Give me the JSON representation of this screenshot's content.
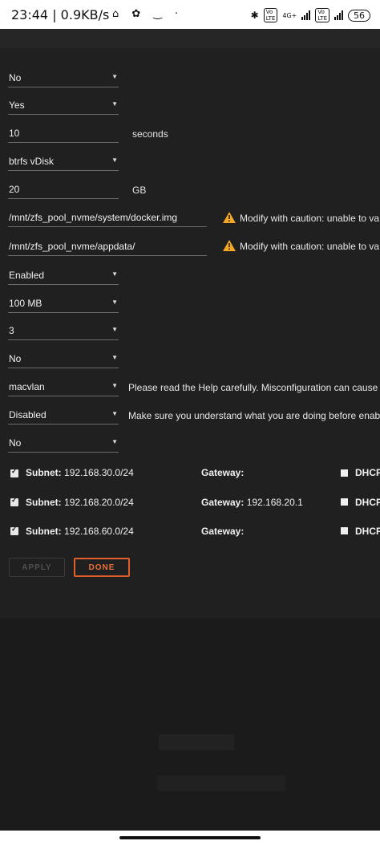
{
  "status_bar": {
    "time": "23:44 | 0.9KB/s",
    "network": "4G+",
    "battery": "56"
  },
  "settings": {
    "select_1": "No",
    "select_2": "Yes",
    "timeout_value": "10",
    "timeout_unit": "seconds",
    "vdisk_type": "btrfs vDisk",
    "vdisk_size": "20",
    "vdisk_unit": "GB",
    "docker_image_path": "/mnt/zfs_pool_nvme/system/docker.img",
    "docker_image_warning": "Modify with caution: unable to va",
    "appdata_path": "/mnt/zfs_pool_nvme/appdata/",
    "appdata_warning": "Modify with caution: unable to va",
    "log_rotation": "Enabled",
    "log_size": "100 MB",
    "log_count": "3",
    "select_no_2": "No",
    "network_type": "macvlan",
    "network_type_note": "Please read the Help carefully. Misconfiguration can cause p",
    "host_access": "Disabled",
    "host_access_note": "Make sure you understand what you are doing before enabl",
    "select_no_3": "No"
  },
  "networks": [
    {
      "subnet_label": "Subnet:",
      "subnet": "192.168.30.0/24",
      "gateway_label": "Gateway:",
      "gateway": "",
      "dhcp_label": "DHCP"
    },
    {
      "subnet_label": "Subnet:",
      "subnet": "192.168.20.0/24",
      "gateway_label": "Gateway:",
      "gateway": "192.168.20.1",
      "dhcp_label": "DHCP"
    },
    {
      "subnet_label": "Subnet:",
      "subnet": "192.168.60.0/24",
      "gateway_label": "Gateway:",
      "gateway": "",
      "dhcp_label": "DHCP"
    }
  ],
  "buttons": {
    "apply": "APPLY",
    "done": "DONE"
  },
  "colors": {
    "accent": "#e05e2b",
    "warning": "#f4a823"
  }
}
